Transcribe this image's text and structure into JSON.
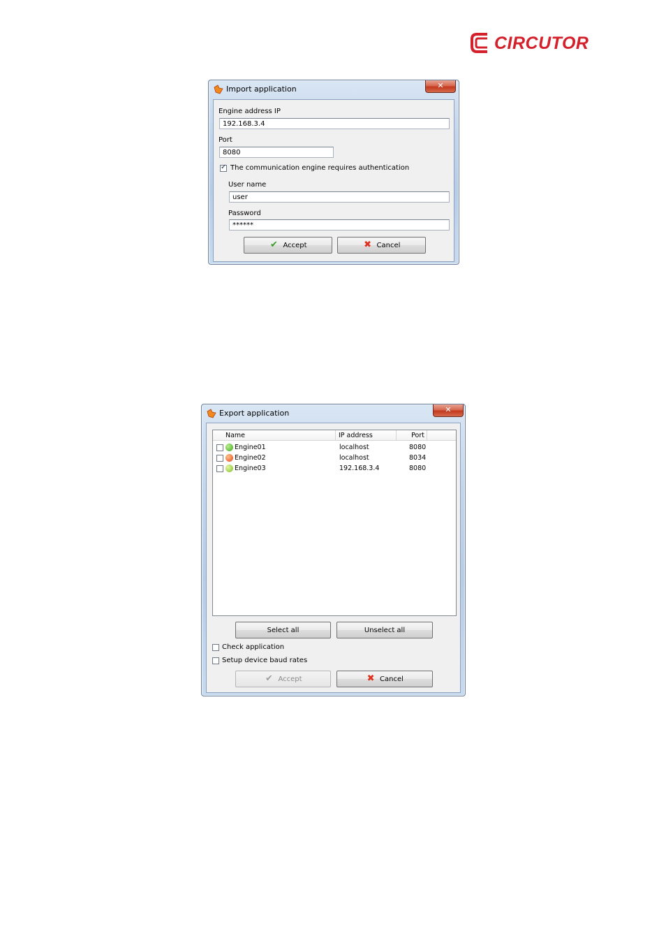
{
  "brand": {
    "name": "CIRCUTOR",
    "color": "#d3202b"
  },
  "import_dialog": {
    "title": "Import application",
    "close_label": "✕",
    "engine_ip_label": "Engine address IP",
    "engine_ip_value": "192.168.3.4",
    "port_label": "Port",
    "port_value": "8080",
    "auth_checkbox_label": "The communication engine requires authentication",
    "auth_checked": true,
    "username_label": "User name",
    "username_value": "user",
    "password_label": "Password",
    "password_value": "******",
    "accept_label": "Accept",
    "cancel_label": "Cancel"
  },
  "export_dialog": {
    "title": "Export application",
    "close_label": "✕",
    "columns": {
      "name": "Name",
      "ip": "IP address",
      "port": "Port"
    },
    "rows": [
      {
        "name": "Engine01",
        "ip": "localhost",
        "port": "8080",
        "status": "running",
        "status_color": "#4cbb2e"
      },
      {
        "name": "Engine02",
        "ip": "localhost",
        "port": "8034",
        "status": "error",
        "status_color": "#e8502a"
      },
      {
        "name": "Engine03",
        "ip": "192.168.3.4",
        "port": "8080",
        "status": "pending",
        "status_color": "#8ccc36"
      }
    ],
    "select_all_label": "Select all",
    "unselect_all_label": "Unselect all",
    "check_application_label": "Check application",
    "setup_baud_label": "Setup device baud rates",
    "accept_label": "Accept",
    "cancel_label": "Cancel"
  }
}
